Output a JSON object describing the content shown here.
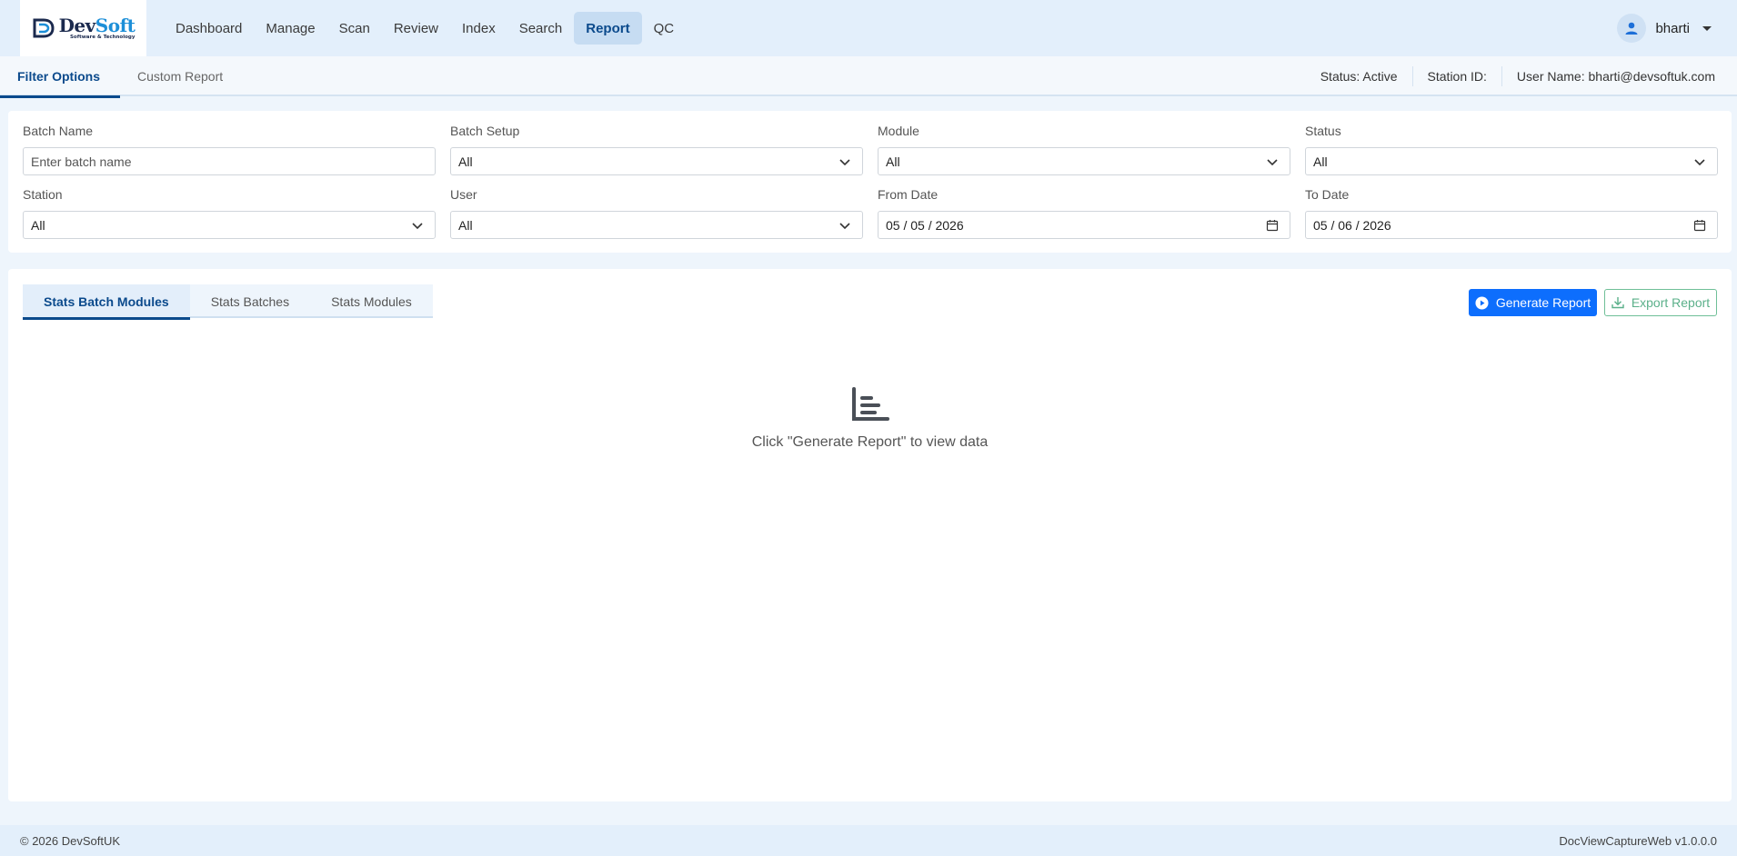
{
  "brand": {
    "name_part1": "Dev",
    "name_part2": "Soft",
    "tagline": "Software & Technology"
  },
  "nav": {
    "items": [
      {
        "label": "Dashboard"
      },
      {
        "label": "Manage"
      },
      {
        "label": "Scan"
      },
      {
        "label": "Review"
      },
      {
        "label": "Index"
      },
      {
        "label": "Search"
      },
      {
        "label": "Report"
      },
      {
        "label": "QC"
      }
    ],
    "active": "Report"
  },
  "user": {
    "name": "bharti"
  },
  "subtabs": {
    "items": [
      {
        "label": "Filter Options"
      },
      {
        "label": "Custom Report"
      }
    ]
  },
  "status_bar": {
    "status": "Status: Active",
    "station": "Station ID:",
    "username": "User Name: bharti@devsoftuk.com"
  },
  "filters": {
    "batch_name": {
      "label": "Batch Name",
      "placeholder": "Enter batch name",
      "value": ""
    },
    "batch_setup": {
      "label": "Batch Setup",
      "value": "All"
    },
    "module": {
      "label": "Module",
      "value": "All"
    },
    "status": {
      "label": "Status",
      "value": "All"
    },
    "station": {
      "label": "Station",
      "value": "All"
    },
    "user": {
      "label": "User",
      "value": "All"
    },
    "from_date": {
      "label": "From Date",
      "value": "05 / 05 / 2026"
    },
    "to_date": {
      "label": "To Date",
      "value": "05 / 06 / 2026"
    }
  },
  "report": {
    "tabs": [
      {
        "label": "Stats Batch Modules"
      },
      {
        "label": "Stats Batches"
      },
      {
        "label": "Stats Modules"
      }
    ],
    "generate_label": "Generate Report",
    "export_label": "Export Report",
    "empty_message": "Click \"Generate Report\" to view data"
  },
  "footer": {
    "copyright": "© 2026 DevSoftUK",
    "version": "DocViewCaptureWeb v1.0.0.0"
  },
  "colors": {
    "primary": "#0d6efd",
    "nav_active": "#0b4a8c",
    "export_green": "#5bb08a",
    "navbar_bg": "#e3effb"
  }
}
